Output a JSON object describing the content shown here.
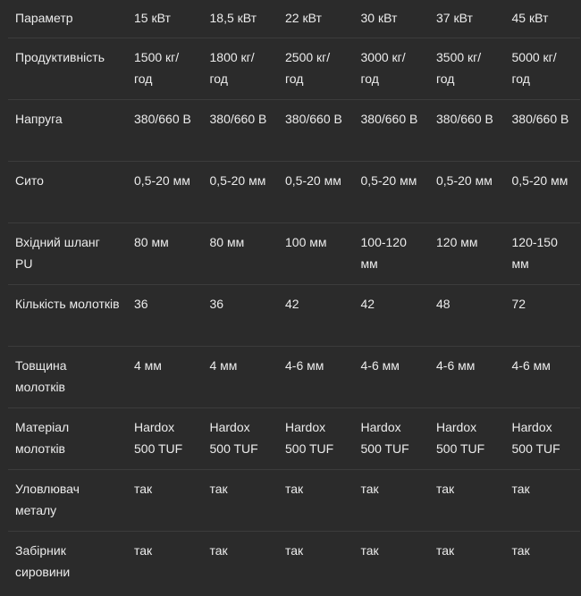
{
  "table": {
    "header": [
      "Параметр",
      "15 кВт",
      "18,5 кВт",
      "22 кВт",
      "30 кВт",
      "37 кВт",
      "45 кВт"
    ],
    "rows": [
      [
        "Продуктивність",
        "1500 кг/год",
        "1800 кг/год",
        "2500 кг/год",
        "3000 кг/год",
        "3500 кг/год",
        "5000 кг/год"
      ],
      [
        "Напруга",
        "380/660 В",
        "380/660 В",
        "380/660 В",
        "380/660 В",
        "380/660 В",
        "380/660 В"
      ],
      [
        "Сито",
        "0,5-20 мм",
        "0,5-20 мм",
        "0,5-20 мм",
        "0,5-20 мм",
        "0,5-20 мм",
        "0,5-20 мм"
      ],
      [
        "Вхідний шланг PU",
        "80 мм",
        "80 мм",
        "100 мм",
        "100-120 мм",
        "120 мм",
        "120-150 мм"
      ],
      [
        "Кількість молотків",
        "36",
        "36",
        "42",
        "42",
        "48",
        "72"
      ],
      [
        "Товщина молотків",
        "4 мм",
        "4 мм",
        "4-6 мм",
        "4-6 мм",
        "4-6 мм",
        "4-6 мм"
      ],
      [
        "Матеріал молотків",
        "Hardox 500 TUF",
        "Hardox 500 TUF",
        "Hardox 500 TUF",
        "Hardox 500 TUF",
        "Hardox 500 TUF",
        "Hardox 500 TUF"
      ],
      [
        "Уловлювач металу",
        "так",
        "так",
        "так",
        "так",
        "так",
        "так"
      ],
      [
        "Забірник сировини",
        "так",
        "так",
        "так",
        "так",
        "так",
        "так"
      ]
    ]
  }
}
